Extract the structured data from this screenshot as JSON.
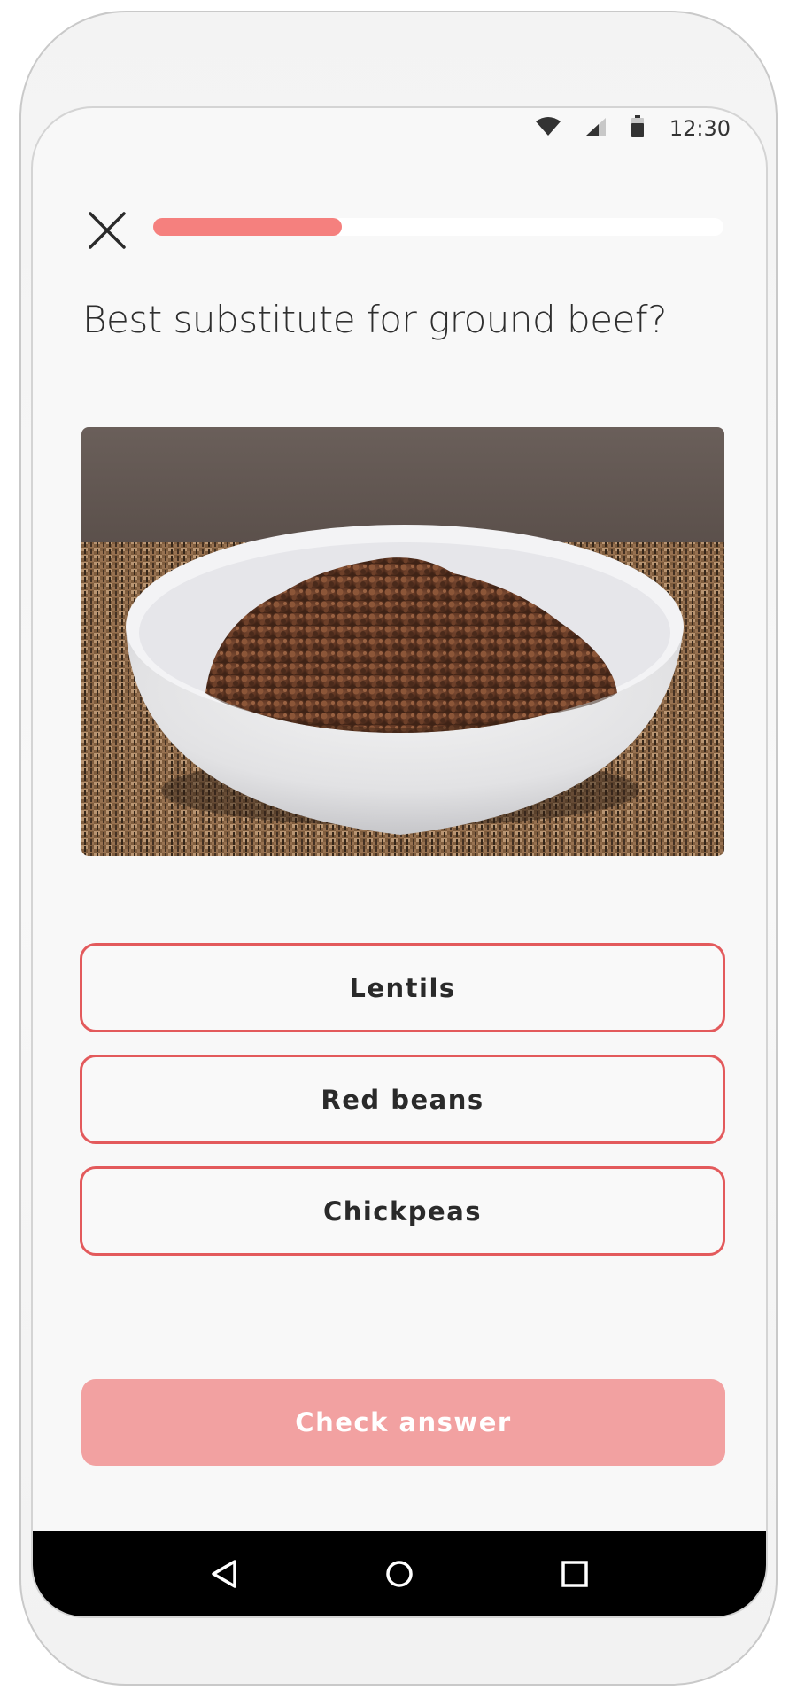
{
  "status_bar": {
    "time": "12:30",
    "icons": [
      "wifi-icon",
      "signal-icon",
      "battery-icon"
    ]
  },
  "quiz": {
    "progress": 0.33,
    "question": "Best substitute for ground beef?",
    "image": "bowl-of-ground-beef",
    "options": [
      "Lentils",
      "Red beans",
      "Chickpeas"
    ],
    "check_label": "Check answer"
  },
  "nav": {
    "icons": [
      "back-icon",
      "home-icon",
      "recents-icon"
    ]
  },
  "colors": {
    "accent": "#f5807e",
    "option_border": "#e35a5c",
    "check_button_disabled": "#f2a1a1",
    "background": "#f8f8f8"
  }
}
